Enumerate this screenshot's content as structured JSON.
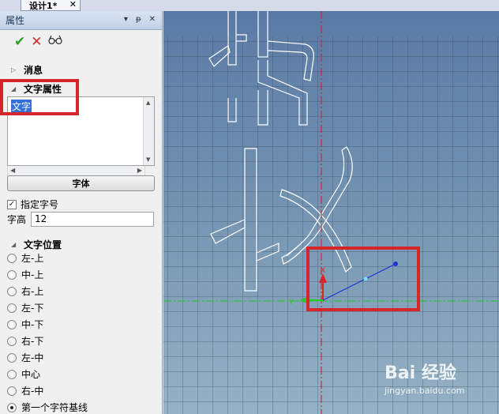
{
  "tab": {
    "title": "设计1*",
    "close_glyph": "✕"
  },
  "panel": {
    "title": "属性",
    "header_icons": [
      "▾",
      "ᵽ",
      "✕"
    ],
    "actions": {
      "ok": "✔",
      "cancel": "✕",
      "preview": "߷"
    },
    "sections": {
      "message": "消息",
      "text_properties": "文字属性",
      "text_position": "文字位置"
    },
    "text_value": "文字",
    "font_button": "字体",
    "specify_size": {
      "label": "指定字号",
      "checked": true
    },
    "char_height": {
      "label": "字高",
      "value": "12"
    },
    "positions": [
      {
        "label": "左-上",
        "selected": false
      },
      {
        "label": "中-上",
        "selected": false
      },
      {
        "label": "右-上",
        "selected": false
      },
      {
        "label": "左-下",
        "selected": false
      },
      {
        "label": "中-下",
        "selected": false
      },
      {
        "label": "右-下",
        "selected": false
      },
      {
        "label": "左-中",
        "selected": false
      },
      {
        "label": "中心",
        "selected": false
      },
      {
        "label": "右-中",
        "selected": false
      },
      {
        "label": "第一个字符基线",
        "selected": true
      }
    ]
  },
  "viewport": {
    "axis_labels": {
      "x": "X",
      "y": "Y"
    },
    "colors": {
      "axis_red": "#d7262b",
      "axis_green": "#22cc22",
      "handle_blue": "#1d35d8",
      "highlight": "#d7262b",
      "outline": "#ffffff"
    }
  },
  "watermark": {
    "main": "Bai 经验",
    "sub": "jingyan.baidu.com"
  }
}
